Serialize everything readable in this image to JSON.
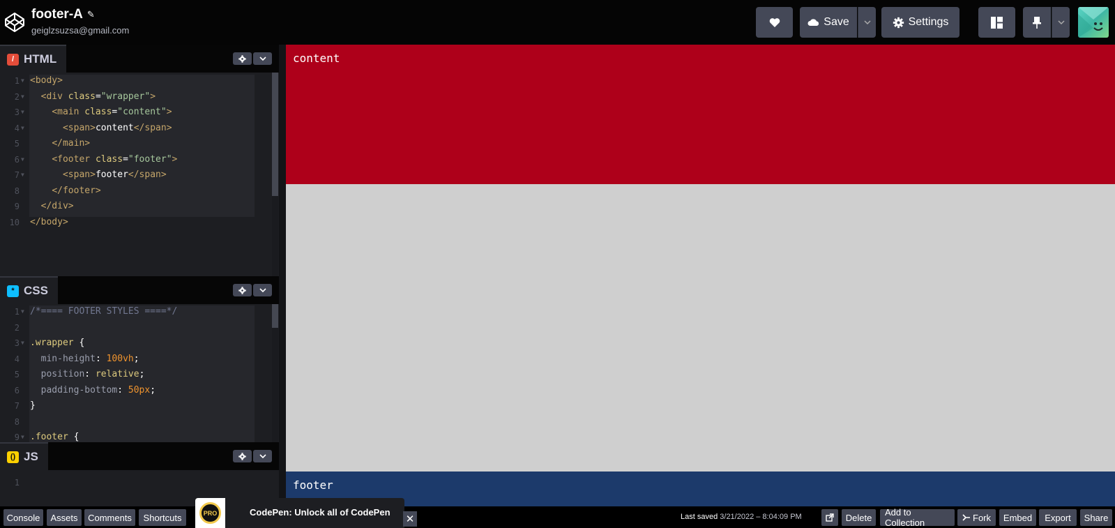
{
  "header": {
    "title": "footer-A",
    "email": "geiglzsuzsa@gmail.com",
    "save_label": "Save",
    "settings_label": "Settings"
  },
  "editors": {
    "html": {
      "label": "HTML",
      "lines": [
        [
          [
            "t-tag",
            "<body>"
          ]
        ],
        [
          [
            "t-pun",
            "  "
          ],
          [
            "t-tag",
            "<div "
          ],
          [
            "t-attr",
            "class"
          ],
          [
            "t-pun",
            "="
          ],
          [
            "t-str",
            "\"wrapper\""
          ],
          [
            "t-tag",
            ">"
          ]
        ],
        [
          [
            "t-pun",
            "    "
          ],
          [
            "t-tag",
            "<main "
          ],
          [
            "t-attr",
            "class"
          ],
          [
            "t-pun",
            "="
          ],
          [
            "t-str",
            "\"content\""
          ],
          [
            "t-tag",
            ">"
          ]
        ],
        [
          [
            "t-pun",
            "      "
          ],
          [
            "t-tag",
            "<span>"
          ],
          [
            "t-txt",
            "content"
          ],
          [
            "t-tag",
            "</span>"
          ]
        ],
        [
          [
            "t-pun",
            "    "
          ],
          [
            "t-tag",
            "</main>"
          ]
        ],
        [
          [
            "t-pun",
            "    "
          ],
          [
            "t-tag",
            "<footer "
          ],
          [
            "t-attr",
            "class"
          ],
          [
            "t-pun",
            "="
          ],
          [
            "t-str",
            "\"footer\""
          ],
          [
            "t-tag",
            ">"
          ]
        ],
        [
          [
            "t-pun",
            "      "
          ],
          [
            "t-tag",
            "<span>"
          ],
          [
            "t-txt",
            "footer"
          ],
          [
            "t-tag",
            "</span>"
          ]
        ],
        [
          [
            "t-pun",
            "    "
          ],
          [
            "t-tag",
            "</footer>"
          ]
        ],
        [
          [
            "t-pun",
            "  "
          ],
          [
            "t-tag",
            "</div>"
          ]
        ],
        [
          [
            "t-tag",
            "</body>"
          ]
        ]
      ]
    },
    "css": {
      "label": "CSS",
      "lines": [
        [
          [
            "t-cmt",
            "/*==== FOOTER STYLES ====*/"
          ]
        ],
        [
          [
            "t-pun",
            ""
          ]
        ],
        [
          [
            "t-sel",
            ".wrapper "
          ],
          [
            "t-pun",
            "{"
          ]
        ],
        [
          [
            "t-pun",
            "  "
          ],
          [
            "t-prop",
            "min-height"
          ],
          [
            "t-pun",
            ": "
          ],
          [
            "t-num",
            "100vh"
          ],
          [
            "t-pun",
            ";"
          ]
        ],
        [
          [
            "t-pun",
            "  "
          ],
          [
            "t-prop",
            "position"
          ],
          [
            "t-pun",
            ": "
          ],
          [
            "t-val",
            "relative"
          ],
          [
            "t-pun",
            ";"
          ]
        ],
        [
          [
            "t-pun",
            "  "
          ],
          [
            "t-prop",
            "padding-bottom"
          ],
          [
            "t-pun",
            ": "
          ],
          [
            "t-num",
            "50px"
          ],
          [
            "t-pun",
            ";"
          ]
        ],
        [
          [
            "t-pun",
            "}"
          ]
        ],
        [
          [
            "t-pun",
            ""
          ]
        ],
        [
          [
            "t-sel",
            ".footer "
          ],
          [
            "t-pun",
            "{"
          ]
        ]
      ]
    },
    "js": {
      "label": "JS",
      "lines": [
        [
          [
            "t-pun",
            ""
          ]
        ]
      ]
    }
  },
  "preview": {
    "content_text": "content",
    "footer_text": "footer"
  },
  "bottom": {
    "console": "Console",
    "assets": "Assets",
    "comments": "Comments",
    "shortcuts": "Shortcuts",
    "saved_prefix": "Last saved",
    "saved_date": "3/21/2022 – 8:04:09 PM",
    "delete": "Delete",
    "add_to_collection": "Add to Collection",
    "fork": "Fork",
    "embed": "Embed",
    "export": "Export",
    "share": "Share"
  },
  "promo": {
    "badge": "PRO",
    "text": "CodePen: Unlock all of CodePen",
    "close": "✕"
  },
  "colors": {
    "content_bg": "#ae001a",
    "footer_bg": "#1c3a6b",
    "preview_bg": "#cfcfcf",
    "button_bg": "#444857"
  }
}
